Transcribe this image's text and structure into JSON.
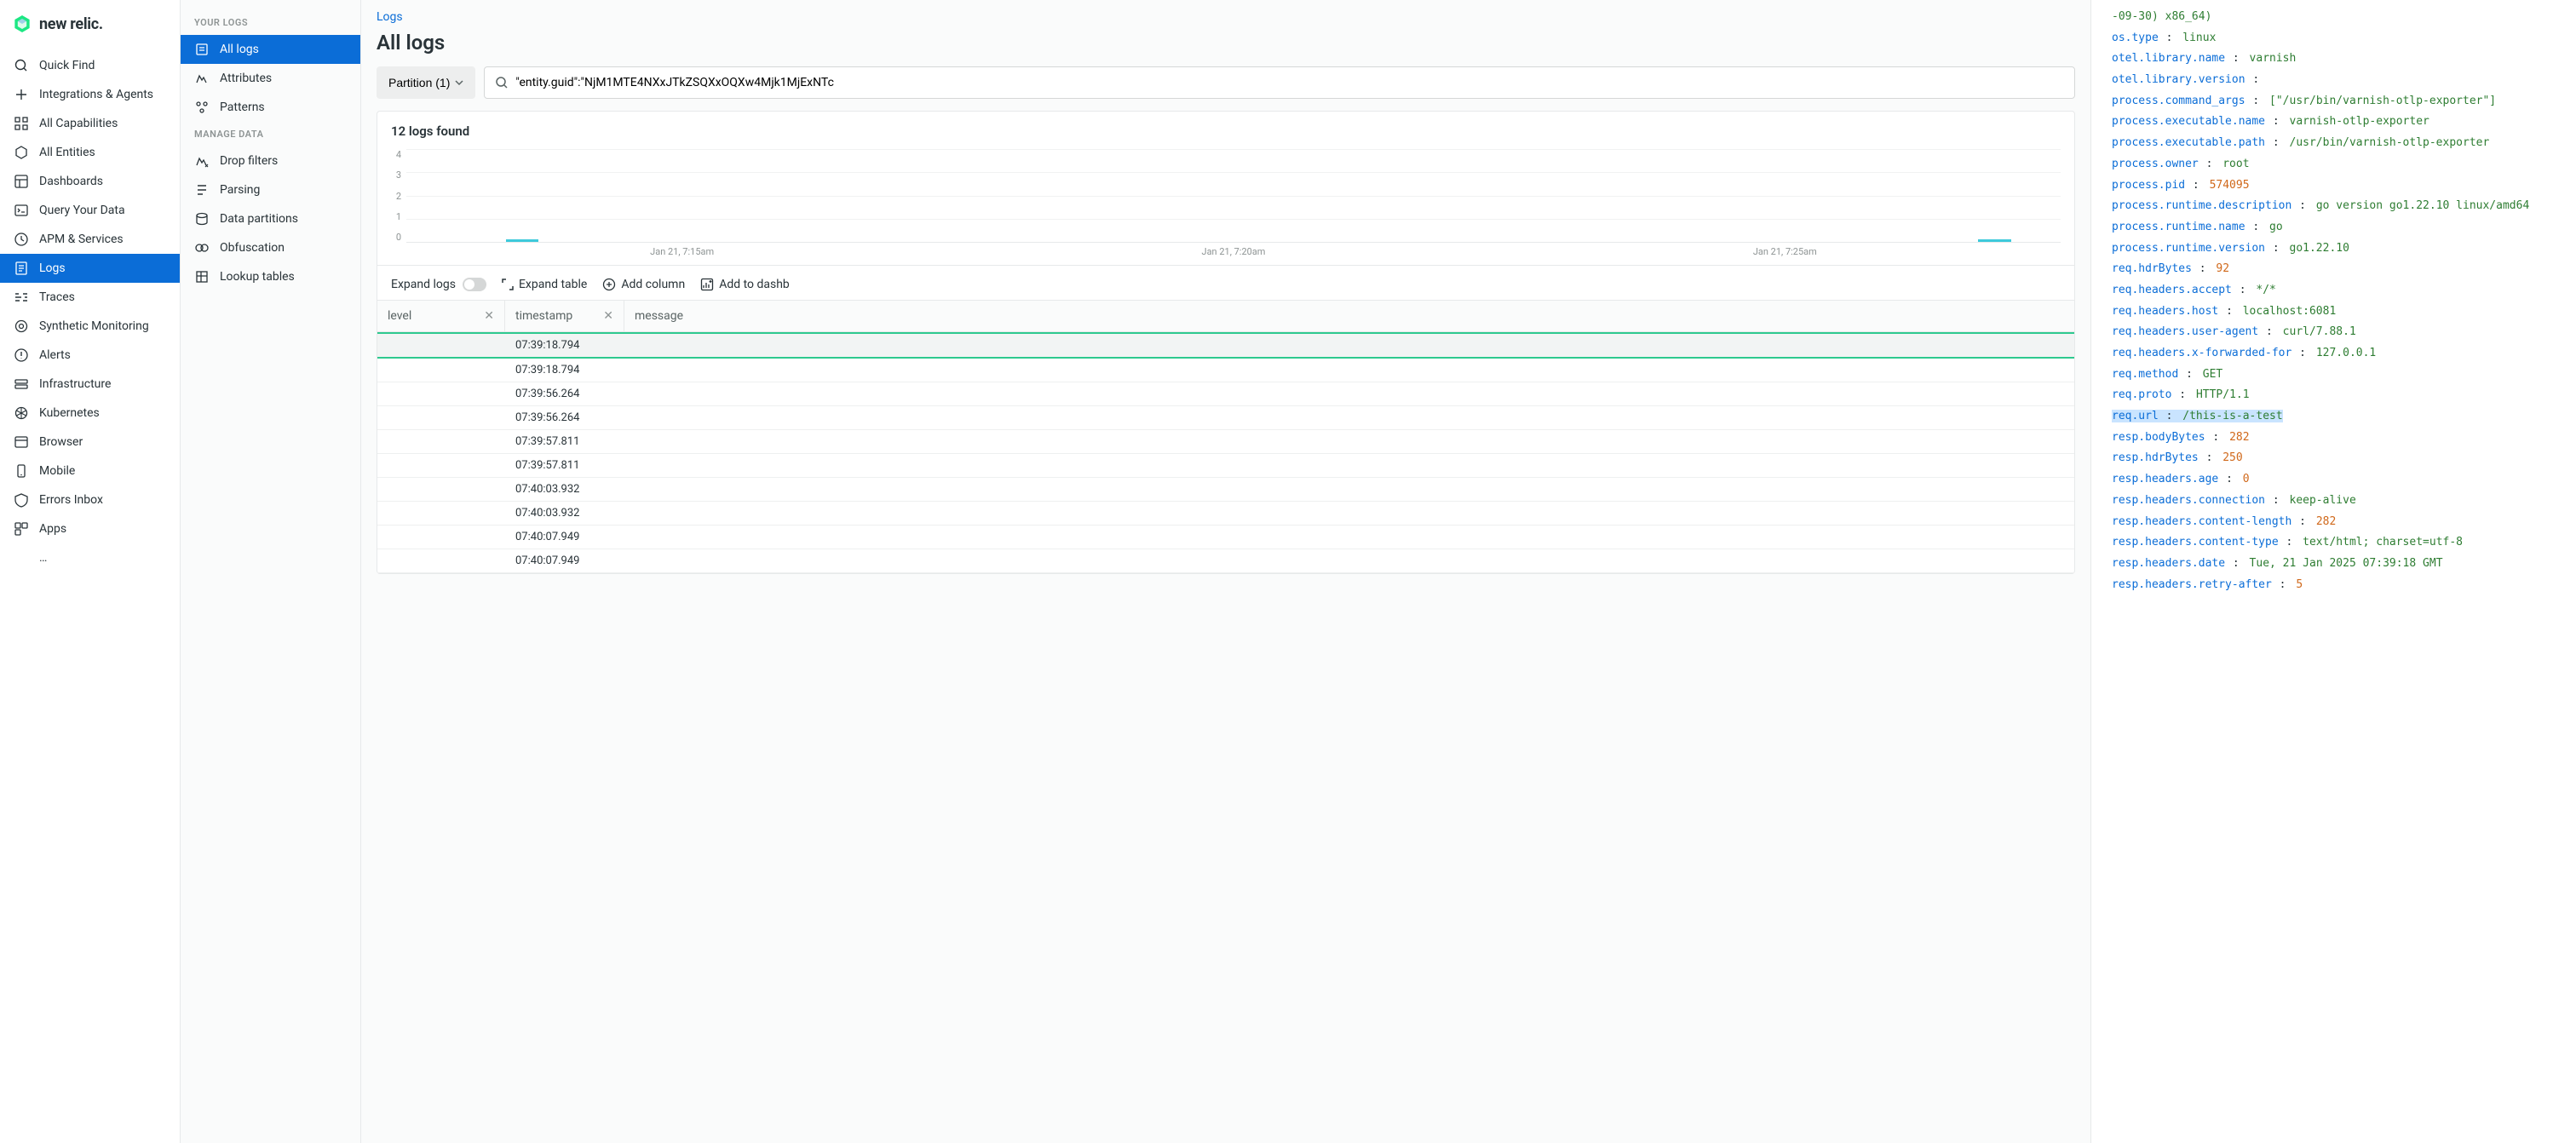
{
  "brand": "new relic.",
  "nav_main": [
    {
      "id": "quick-find",
      "label": "Quick Find"
    },
    {
      "id": "integrations",
      "label": "Integrations & Agents"
    },
    {
      "id": "capabilities",
      "label": "All Capabilities"
    },
    {
      "id": "entities",
      "label": "All Entities"
    },
    {
      "id": "dashboards",
      "label": "Dashboards"
    },
    {
      "id": "query",
      "label": "Query Your Data"
    },
    {
      "id": "apm",
      "label": "APM & Services"
    },
    {
      "id": "logs",
      "label": "Logs",
      "active": true
    },
    {
      "id": "traces",
      "label": "Traces"
    },
    {
      "id": "synthetic",
      "label": "Synthetic Monitoring"
    },
    {
      "id": "alerts",
      "label": "Alerts"
    },
    {
      "id": "infra",
      "label": "Infrastructure"
    },
    {
      "id": "k8s",
      "label": "Kubernetes"
    },
    {
      "id": "browser",
      "label": "Browser"
    },
    {
      "id": "mobile",
      "label": "Mobile"
    },
    {
      "id": "errors",
      "label": "Errors Inbox"
    },
    {
      "id": "apps",
      "label": "Apps"
    },
    {
      "id": "more",
      "label": "…"
    }
  ],
  "sec_groups": [
    {
      "header": "YOUR LOGS",
      "items": [
        {
          "id": "all-logs",
          "label": "All logs",
          "active": true
        },
        {
          "id": "attributes",
          "label": "Attributes"
        },
        {
          "id": "patterns",
          "label": "Patterns"
        }
      ]
    },
    {
      "header": "MANAGE DATA",
      "items": [
        {
          "id": "drop-filters",
          "label": "Drop filters"
        },
        {
          "id": "parsing",
          "label": "Parsing"
        },
        {
          "id": "data-partitions",
          "label": "Data partitions"
        },
        {
          "id": "obfuscation",
          "label": "Obfuscation"
        },
        {
          "id": "lookup-tables",
          "label": "Lookup tables"
        }
      ]
    }
  ],
  "breadcrumb": "Logs",
  "title": "All logs",
  "filter": {
    "partition_label": "Partition (1)",
    "query": "\"entity.guid\":\"NjM1MTE4NXxJTkZSQXxOQXw4Mjk1MjExNTc"
  },
  "results": {
    "count_label": "12 logs found",
    "toolbar": {
      "expand_logs": "Expand logs",
      "expand_table": "Expand table",
      "add_column": "Add column",
      "add_dashboard": "Add to dashb"
    },
    "columns": {
      "level": "level",
      "timestamp": "timestamp",
      "message": "message"
    },
    "rows": [
      {
        "ts": "07:39:18.794"
      },
      {
        "ts": "07:39:18.794"
      },
      {
        "ts": "07:39:56.264"
      },
      {
        "ts": "07:39:56.264"
      },
      {
        "ts": "07:39:57.811"
      },
      {
        "ts": "07:39:57.811"
      },
      {
        "ts": "07:40:03.932"
      },
      {
        "ts": "07:40:03.932"
      },
      {
        "ts": "07:40:07.949"
      },
      {
        "ts": "07:40:07.949"
      }
    ]
  },
  "chart_data": {
    "type": "bar",
    "ylim": [
      0,
      4
    ],
    "yticks": [
      4,
      3,
      2,
      1,
      0
    ],
    "categories": [
      "Jan 21,\n7:15am",
      "Jan 21,\n7:20am",
      "Jan 21,\n7:25am"
    ],
    "bars": [
      {
        "pos_pct": 6,
        "value": 0.1
      },
      {
        "pos_pct": 95,
        "value": 0.1
      }
    ]
  },
  "detail_top_fragment": "-09-30) x86_64)",
  "detail": [
    {
      "k": "os.type",
      "v": "linux",
      "t": "str"
    },
    {
      "k": "otel.library.name",
      "v": "varnish",
      "t": "str"
    },
    {
      "k": "otel.library.version",
      "v": "",
      "t": "str"
    },
    {
      "k": "process.command_args",
      "v": "[\"/usr/bin/varnish-otlp-exporter\"]",
      "t": "str"
    },
    {
      "k": "process.executable.name",
      "v": "varnish-otlp-exporter",
      "t": "str"
    },
    {
      "k": "process.executable.path",
      "v": "/usr/bin/varnish-otlp-exporter",
      "t": "str"
    },
    {
      "k": "process.owner",
      "v": "root",
      "t": "str"
    },
    {
      "k": "process.pid",
      "v": "574095",
      "t": "num"
    },
    {
      "k": "process.runtime.description",
      "v": "go version go1.22.10 linux/amd64",
      "t": "str"
    },
    {
      "k": "process.runtime.name",
      "v": "go",
      "t": "str"
    },
    {
      "k": "process.runtime.version",
      "v": "go1.22.10",
      "t": "str"
    },
    {
      "k": "req.hdrBytes",
      "v": "92",
      "t": "num"
    },
    {
      "k": "req.headers.accept",
      "v": "*/*",
      "t": "str"
    },
    {
      "k": "req.headers.host",
      "v": "localhost:6081",
      "t": "str"
    },
    {
      "k": "req.headers.user-agent",
      "v": "curl/7.88.1",
      "t": "str"
    },
    {
      "k": "req.headers.x-forwarded-for",
      "v": "127.0.0.1",
      "t": "str"
    },
    {
      "k": "req.method",
      "v": "GET",
      "t": "const"
    },
    {
      "k": "req.proto",
      "v": "HTTP/1.1",
      "t": "str"
    },
    {
      "k": "req.url",
      "v": "/this-is-a-test",
      "t": "str",
      "hl": true
    },
    {
      "k": "resp.bodyBytes",
      "v": "282",
      "t": "num"
    },
    {
      "k": "resp.hdrBytes",
      "v": "250",
      "t": "num"
    },
    {
      "k": "resp.headers.age",
      "v": "0",
      "t": "num"
    },
    {
      "k": "resp.headers.connection",
      "v": "keep-alive",
      "t": "str"
    },
    {
      "k": "resp.headers.content-length",
      "v": "282",
      "t": "num"
    },
    {
      "k": "resp.headers.content-type",
      "v": "text/html; charset=utf-8",
      "t": "str"
    },
    {
      "k": "resp.headers.date",
      "v": "Tue, 21 Jan 2025 07:39:18 GMT",
      "t": "str"
    },
    {
      "k": "resp.headers.retry-after",
      "v": "5",
      "t": "num"
    }
  ]
}
